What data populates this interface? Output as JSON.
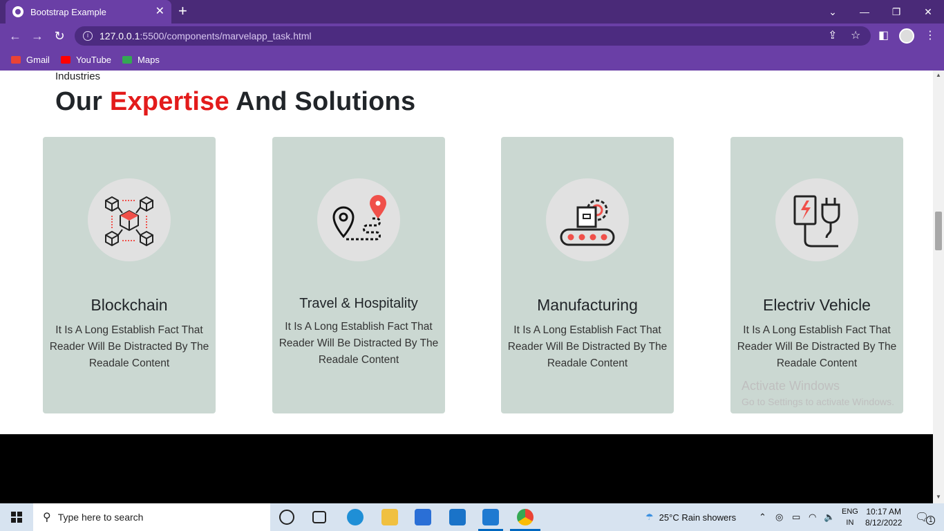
{
  "browser": {
    "tab_title": "Bootstrap Example",
    "tab_close": "✕",
    "new_tab": "+",
    "url_host": "127.0.0.1",
    "url_path": ":5500/components/marvelapp_task.html",
    "bookmarks": [
      {
        "label": "Gmail",
        "color": "#ea4335"
      },
      {
        "label": "YouTube",
        "color": "#ff0000"
      },
      {
        "label": "Maps",
        "color": "#34a853"
      }
    ]
  },
  "page": {
    "kicker": "Industries",
    "heading_part1": "Our ",
    "heading_accent": "Expertise",
    "heading_part2": " And Solutions",
    "accent_color": "#e31b1b",
    "card_color": "#cbd8d2",
    "cards": [
      {
        "title": "Blockchain",
        "desc": "It Is A Long Establish Fact That Reader Will Be Distracted By The Readale Content",
        "icon": "blockchain-icon"
      },
      {
        "title": "Travel & Hospitality",
        "desc": "It Is A Long Establish Fact That Reader Will Be Distracted By The Readale Content",
        "icon": "map-pin-route-icon"
      },
      {
        "title": "Manufacturing",
        "desc": "It Is A Long Establish Fact That Reader Will Be Distracted By The Readale Content",
        "icon": "conveyor-gear-icon"
      },
      {
        "title": "Electriv Vehicle",
        "desc": "It Is A Long Establish Fact That Reader Will Be Distracted By The Readale Content",
        "icon": "ev-charger-plug-icon"
      }
    ]
  },
  "watermark": {
    "line1": "Activate Windows",
    "line2": "Go to Settings to activate Windows."
  },
  "taskbar": {
    "search_placeholder": "Type here to search",
    "weather": "25°C  Rain showers",
    "lang1": "ENG",
    "lang2": "IN",
    "time": "10:17 AM",
    "date": "8/12/2022",
    "notification_count": "1"
  }
}
